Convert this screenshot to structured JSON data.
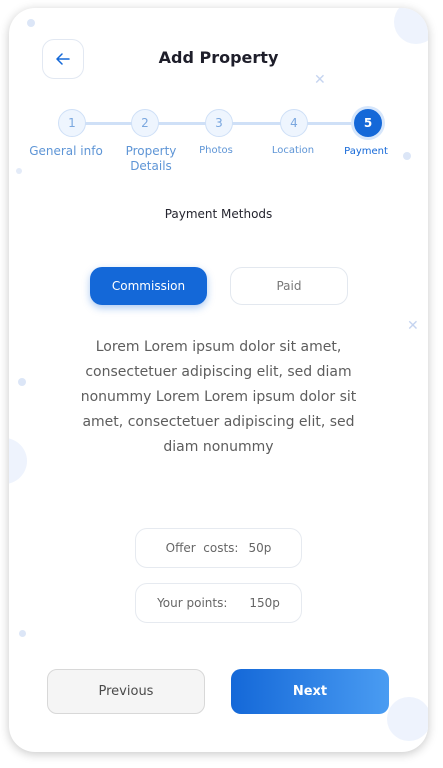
{
  "header": {
    "back_icon": "arrow-left-icon",
    "title": "Add Property"
  },
  "stepper": {
    "active_step": 5,
    "steps": [
      {
        "number": "1",
        "label": "General info"
      },
      {
        "number": "2",
        "label_line1": "Property",
        "label_line2": "Details"
      },
      {
        "number": "3",
        "label": "Photos"
      },
      {
        "number": "4",
        "label": "Location"
      },
      {
        "number": "5",
        "label": "Payment"
      }
    ]
  },
  "payment": {
    "section_title": "Payment Methods",
    "selected": "Commission",
    "options": [
      {
        "label": "Commission"
      },
      {
        "label": "Paid"
      }
    ],
    "description": "Lorem Lorem ipsum dolor sit amet, consectetuer adipiscing elit, sed diam nonummy Lorem Lorem ipsum dolor sit amet, consectetuer adipiscing elit, sed diam nonummy",
    "offer_costs": {
      "label": "Offer  costs:",
      "value": "50p"
    },
    "your_points": {
      "label": "Your points:",
      "value": "150p"
    }
  },
  "footer": {
    "previous_label": "Previous",
    "next_label": "Next"
  },
  "colors": {
    "primary": "#1468d8",
    "step_inactive": "#cfe0f7",
    "step_text": "#5e95d6"
  }
}
